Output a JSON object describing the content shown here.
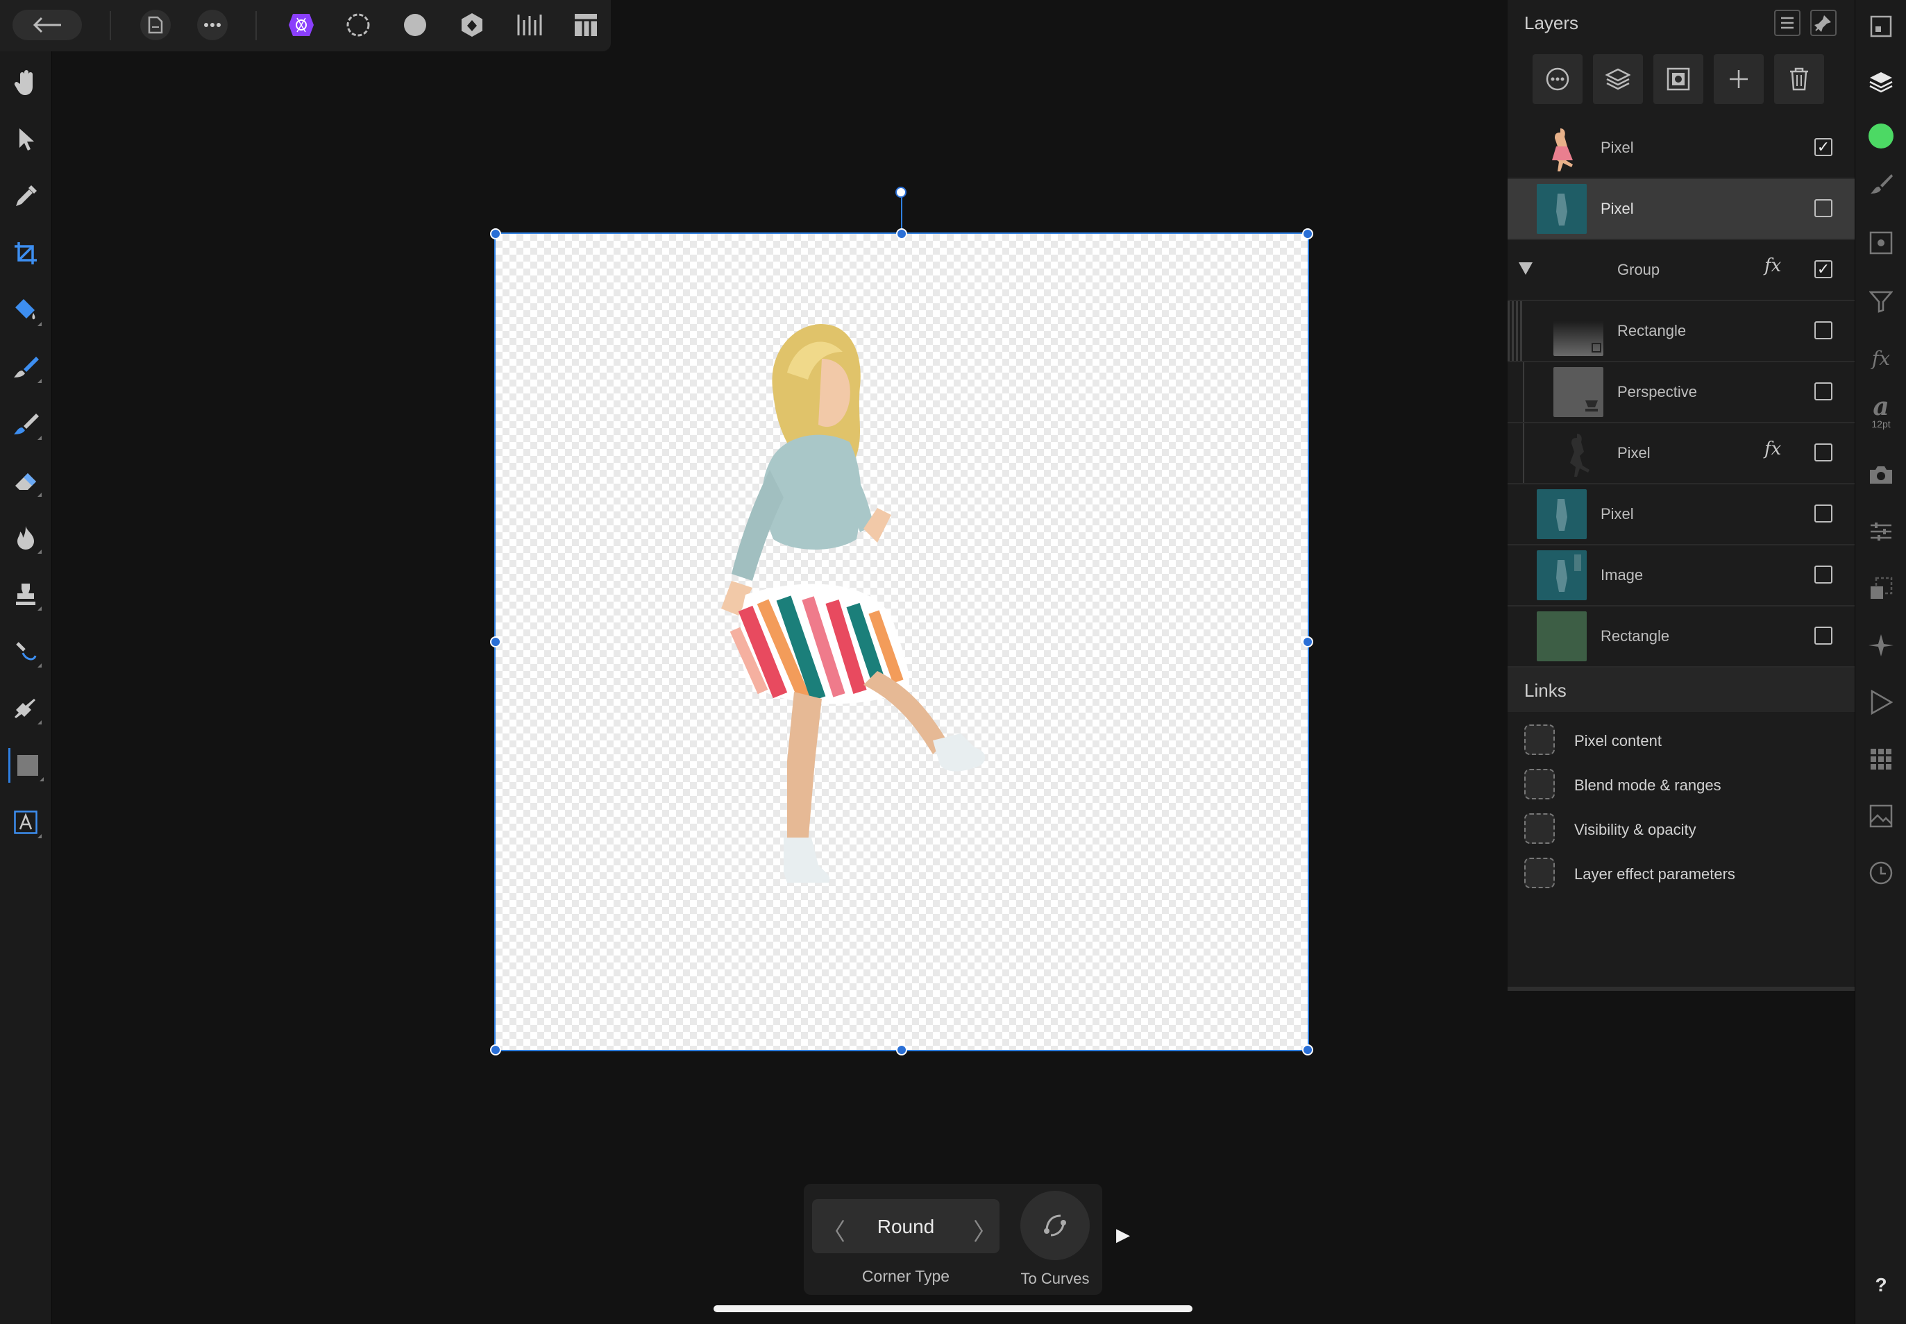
{
  "toolbar": {
    "back_icon": "arrow-left-icon",
    "document_icon": "document-icon",
    "more_icon": "ellipsis-icon",
    "personas": [
      "photo-persona-icon",
      "liquify-persona-icon",
      "develop-persona-icon",
      "tone-mapping-persona-icon",
      "export-persona-icon"
    ],
    "view_icon": "view-mode-icon",
    "accent": "#8a3ffc"
  },
  "tools": [
    "hand",
    "move",
    "color-picker",
    "crop",
    "flood-fill",
    "selection-brush",
    "paint-brush",
    "erase-brush",
    "dodge-burn",
    "clone",
    "healing",
    "pen",
    "rectangle",
    "text"
  ],
  "layers_panel": {
    "title": "Layers",
    "actions": [
      "blend-options",
      "layer-mask",
      "adjustment",
      "add-layer",
      "delete-layer"
    ],
    "layers": [
      {
        "name": "Pixel",
        "checked": true,
        "fx": false,
        "thumb": "dancer"
      },
      {
        "name": "Pixel",
        "checked": false,
        "fx": false,
        "thumb": "teal",
        "selected": true
      },
      {
        "name": "Group",
        "checked": true,
        "fx": true,
        "thumb": "none",
        "group": true
      },
      {
        "name": "Rectangle",
        "checked": false,
        "fx": false,
        "thumb": "gradient",
        "child": true
      },
      {
        "name": "Perspective",
        "checked": false,
        "fx": false,
        "thumb": "grey",
        "child": true
      },
      {
        "name": "Pixel",
        "checked": false,
        "fx": true,
        "thumb": "silhouette",
        "child": true
      },
      {
        "name": "Pixel",
        "checked": false,
        "fx": false,
        "thumb": "teal"
      },
      {
        "name": "Image",
        "checked": false,
        "fx": false,
        "thumb": "teal"
      },
      {
        "name": "Rectangle",
        "checked": false,
        "fx": false,
        "thumb": "green"
      }
    ],
    "fx_label": "fx",
    "check_mark": "✓"
  },
  "links": {
    "title": "Links",
    "items": [
      "Pixel content",
      "Blend mode & ranges",
      "Visibility & opacity",
      "Layer effect parameters"
    ]
  },
  "studio_strip": {
    "font_label": "a",
    "font_size": "12pt",
    "color_swatch": "#4cd964",
    "help": "?"
  },
  "context": {
    "corner_value": "Round",
    "corner_label": "Corner Type",
    "to_curves_label": "To Curves",
    "prev": "〈",
    "next": "〉",
    "play": "▶"
  }
}
